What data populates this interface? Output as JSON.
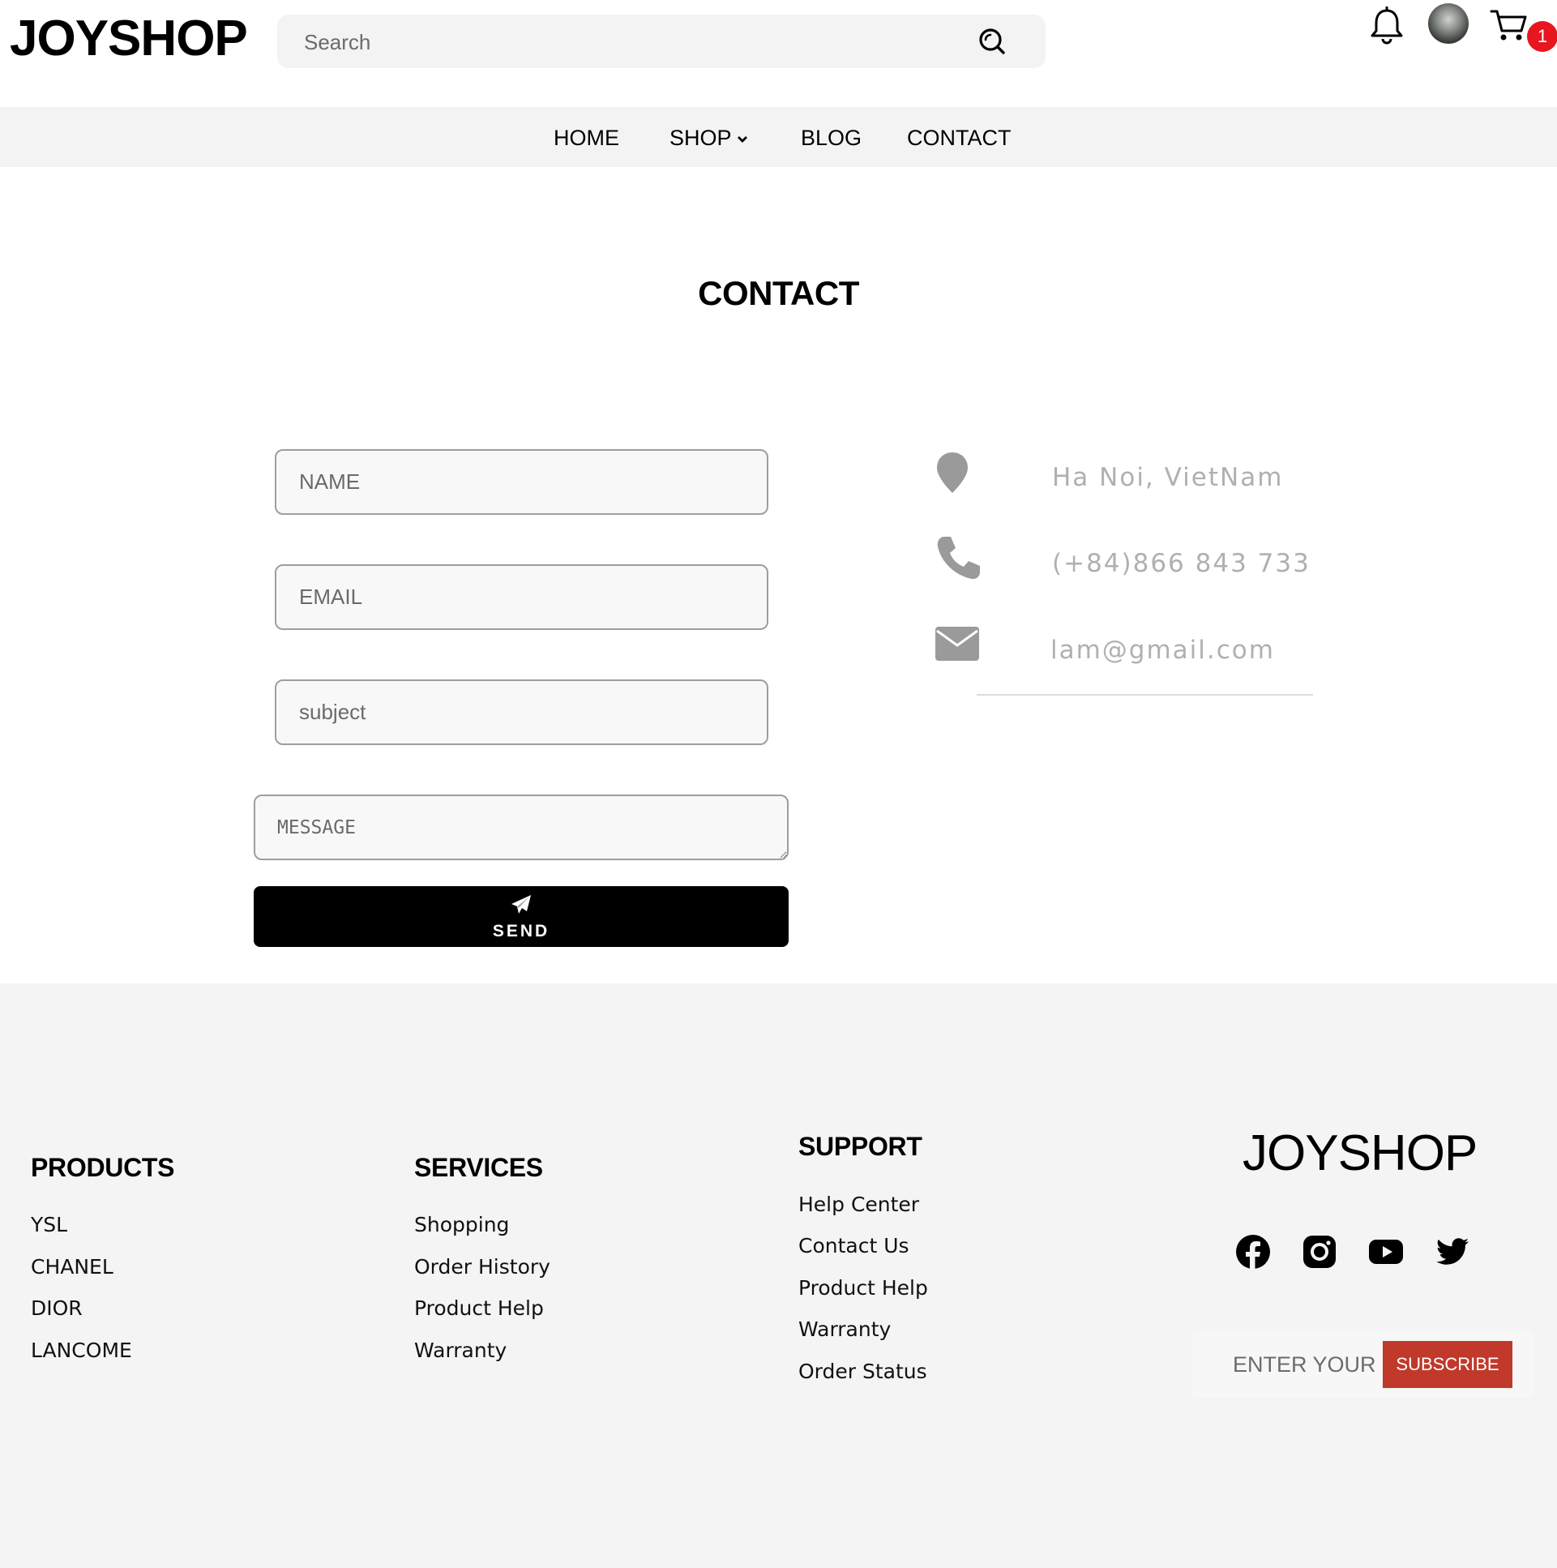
{
  "header": {
    "logo": "JOYSHOP",
    "search_placeholder": "Search",
    "cart_count": "1"
  },
  "nav": {
    "items": [
      {
        "label": "HOME"
      },
      {
        "label": "SHOP",
        "has_dropdown": true
      },
      {
        "label": "BLOG"
      },
      {
        "label": "CONTACT"
      }
    ]
  },
  "contact": {
    "title": "CONTACT",
    "form": {
      "name_placeholder": "NAME",
      "email_placeholder": "EMAIL",
      "subject_placeholder": "subject",
      "message_placeholder": "MESSAGE",
      "send_label": "SEND"
    },
    "info": {
      "address": "Ha Noi, VietNam",
      "phone": "(+84)866 843 733",
      "email": "lam@gmail.com"
    }
  },
  "footer": {
    "products": {
      "heading": "PRODUCTS",
      "links": [
        "YSL",
        "CHANEL",
        "DIOR",
        "LANCOME"
      ]
    },
    "services": {
      "heading": "SERVICES",
      "links": [
        "Shopping",
        "Order History",
        "Product Help",
        "Warranty"
      ]
    },
    "support": {
      "heading": "SUPPORT",
      "links": [
        "Help Center",
        "Contact Us",
        "Product Help",
        "Warranty",
        "Order Status"
      ]
    },
    "brand": {
      "logo": "JOYSHOP",
      "socials": [
        "facebook-icon",
        "instagram-icon",
        "youtube-icon",
        "twitter-icon"
      ]
    },
    "newsletter": {
      "placeholder": "ENTER YOUR EMAIL",
      "button_label": "SUBSCRIBE"
    }
  },
  "colors": {
    "badge": "#e8161e",
    "subscribe": "#c0392b",
    "info_text": "#b0b0b0",
    "info_icon": "#9a9a9a"
  }
}
